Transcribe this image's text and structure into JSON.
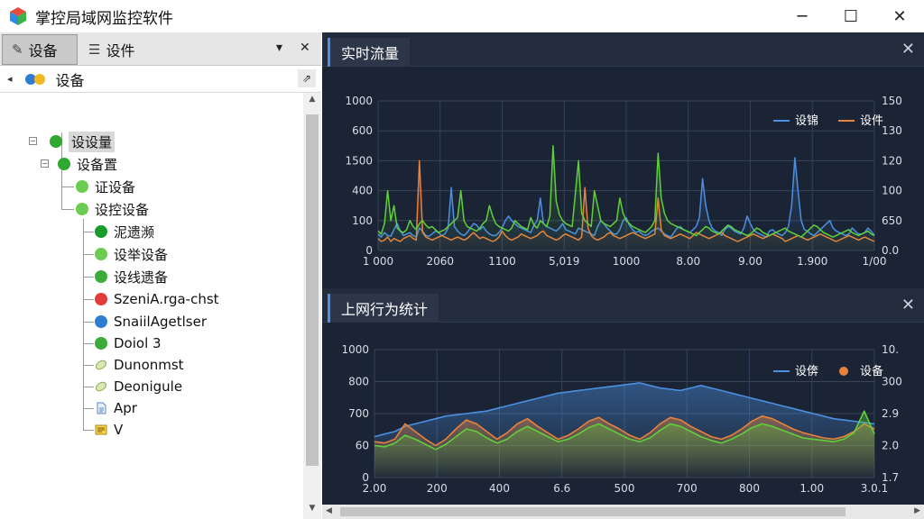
{
  "window": {
    "title": "掌控局域网监控软件",
    "minimize": "─",
    "maximize": "☐",
    "close": "✕"
  },
  "left_tabs": [
    {
      "label": "设备",
      "icon": "pen-icon"
    },
    {
      "label": "设件",
      "icon": "list-icon"
    }
  ],
  "tab_menu": "▾",
  "tab_close": "✕",
  "tree_root": {
    "label": "设备"
  },
  "tree": [
    {
      "label": "设设量",
      "color": "#2ea82e",
      "selected": true
    },
    {
      "label": "设备置",
      "color": "#2ea82e"
    },
    {
      "label": "证设备",
      "color": "#6ccc4f"
    },
    {
      "label": "设控设备",
      "color": "#6ccc4f"
    },
    {
      "label": "泥遗濒",
      "color": "#169c2a"
    },
    {
      "label": "设举设备",
      "color": "#6ccc4f"
    },
    {
      "label": "设线遗备",
      "color": "#3bab3b"
    },
    {
      "label": "SzeniA.rga-chst",
      "color": "#e23b3b"
    },
    {
      "label": "SnaiilAgetlser",
      "color": "#2f7dd1"
    },
    {
      "label": "Doiol 3",
      "color": "#3bab3b"
    },
    {
      "label": "Dunonmst",
      "icon": "leaf-icon"
    },
    {
      "label": "Deonigule",
      "icon": "leaf-icon"
    },
    {
      "label": "Apr",
      "icon": "doc-icon"
    },
    {
      "label": "V",
      "icon": "note-icon"
    }
  ],
  "colors": {
    "blue": "#4a90e2",
    "orange": "#e8823a",
    "green": "#5fcf3a",
    "accent": "#4d8fe0"
  },
  "panels": {
    "realtime": {
      "title": "实时流量",
      "close": "✕"
    },
    "behavior": {
      "title": "上网行为统计",
      "close": "✕"
    }
  },
  "chart_data": [
    {
      "type": "line",
      "legend": "top-right",
      "legend_items": [
        {
          "name": "设锦",
          "color": "#4a90e2"
        },
        {
          "name": "设件",
          "color": "#e8823a"
        }
      ],
      "y_ticks": [
        "1000",
        "600",
        "1500",
        "400",
        "100",
        "0"
      ],
      "y2_ticks": [
        "150",
        "130",
        "120",
        "100",
        "650",
        "0.0"
      ],
      "x_ticks": [
        "1 000",
        "2060",
        "1100",
        "5,019",
        "1000",
        "8.00",
        "9.00",
        "1.900",
        "1/00"
      ],
      "ylim": [
        0,
        1000
      ],
      "grid": true,
      "series": [
        {
          "color": "#4a90e2",
          "values": [
            110,
            90,
            120,
            100,
            95,
            140,
            180,
            130,
            100,
            110,
            120,
            100,
            90,
            150,
            130,
            100,
            95,
            110,
            130,
            120,
            100,
            110,
            150,
            420,
            160,
            130,
            110,
            100,
            120,
            150,
            180,
            170,
            140,
            160,
            130,
            110,
            100,
            100,
            120,
            150,
            200,
            230,
            200,
            180,
            160,
            150,
            140,
            130,
            120,
            170,
            200,
            350,
            180,
            160,
            150,
            140,
            130,
            150,
            180,
            140,
            130,
            120,
            110,
            150,
            140,
            130,
            120,
            110,
            100,
            160,
            200,
            180,
            150,
            130,
            110,
            110,
            140,
            200,
            220,
            170,
            140,
            120,
            130,
            110,
            100,
            110,
            130,
            140,
            150,
            130,
            110,
            100,
            90,
            120,
            150,
            160,
            140,
            130,
            120,
            140,
            160,
            220,
            480,
            300,
            200,
            150,
            130,
            120,
            100,
            140,
            160,
            150,
            130,
            120,
            110,
            150,
            230,
            180,
            140,
            120,
            110,
            100,
            90,
            130,
            140,
            120,
            110,
            100,
            120,
            160,
            300,
            620,
            400,
            200,
            140,
            130,
            110,
            100,
            120,
            140,
            160,
            180,
            200,
            150,
            130,
            120,
            110,
            100,
            110,
            150,
            130,
            110,
            110,
            120,
            150,
            130,
            100
          ]
        },
        {
          "color": "#e8823a",
          "values": [
            80,
            60,
            70,
            90,
            60,
            80,
            70,
            60,
            80,
            90,
            100,
            80,
            70,
            600,
            120,
            90,
            80,
            70,
            80,
            90,
            100,
            90,
            80,
            70,
            80,
            90,
            80,
            70,
            80,
            100,
            120,
            100,
            80,
            90,
            80,
            70,
            60,
            70,
            90,
            130,
            100,
            80,
            70,
            80,
            90,
            110,
            100,
            90,
            80,
            90,
            100,
            120,
            130,
            100,
            90,
            80,
            70,
            80,
            100,
            110,
            100,
            90,
            80,
            70,
            90,
            420,
            150,
            100,
            80,
            70,
            80,
            90,
            110,
            120,
            100,
            90,
            80,
            90,
            100,
            110,
            120,
            110,
            100,
            90,
            80,
            90,
            100,
            110,
            350,
            140,
            100,
            90,
            80,
            90,
            100,
            110,
            100,
            90,
            80,
            100,
            120,
            110,
            100,
            90,
            80,
            90,
            100,
            110,
            120,
            100,
            90,
            80,
            70,
            60,
            70,
            80,
            90,
            100,
            110,
            100,
            90,
            80,
            90,
            100,
            110,
            100,
            90,
            80,
            60,
            70,
            80,
            90,
            100,
            90,
            80,
            70,
            80,
            90,
            100,
            110,
            100,
            90,
            80,
            70,
            60,
            70,
            80,
            90,
            100,
            90,
            80,
            70,
            80,
            90,
            80,
            70,
            60
          ]
        },
        {
          "color": "#5fcf3a",
          "values": [
            130,
            110,
            180,
            400,
            200,
            300,
            150,
            130,
            120,
            140,
            200,
            160,
            140,
            180,
            200,
            170,
            150,
            160,
            140,
            120,
            130,
            140,
            160,
            180,
            200,
            220,
            400,
            200,
            160,
            150,
            140,
            130,
            150,
            180,
            200,
            300,
            230,
            180,
            160,
            150,
            140,
            130,
            150,
            200,
            180,
            160,
            150,
            140,
            220,
            170,
            150,
            200,
            180,
            160,
            230,
            700,
            330,
            240,
            200,
            180,
            170,
            160,
            380,
            600,
            250,
            200,
            180,
            160,
            400,
            300,
            200,
            180,
            170,
            160,
            180,
            200,
            350,
            250,
            200,
            180,
            160,
            150,
            140,
            130,
            120,
            140,
            160,
            200,
            650,
            350,
            250,
            200,
            180,
            170,
            160,
            150,
            140,
            130,
            120,
            110,
            100,
            120,
            140,
            160,
            150,
            130,
            120,
            110,
            130,
            150,
            170,
            160,
            140,
            130,
            120,
            110,
            100,
            110,
            130,
            150,
            140,
            120,
            110,
            100,
            110,
            120,
            130,
            140,
            150,
            130,
            120,
            110,
            100,
            90,
            110,
            130,
            150,
            170,
            160,
            140,
            120,
            110,
            100,
            90,
            100,
            110,
            120,
            130,
            140,
            120,
            110,
            100,
            110,
            120,
            130,
            110,
            100
          ]
        }
      ]
    },
    {
      "type": "area",
      "legend": "top-right",
      "legend_items": [
        {
          "name": "设倴",
          "color": "#4a90e2"
        },
        {
          "name": "设备",
          "color": "#e8823a"
        }
      ],
      "y_ticks": [
        "1000",
        "800",
        "700",
        "60",
        "0"
      ],
      "y2_ticks": [
        "10.",
        "300",
        "2.9",
        "2.0",
        "1.7"
      ],
      "x_ticks": [
        "2.00",
        "200",
        "400",
        "6.6",
        "500",
        "700",
        "800",
        "1.00",
        "3.0.1"
      ],
      "ylim": [
        0,
        1000
      ],
      "grid": true,
      "series": [
        {
          "color": "#4a90e2",
          "values": [
            320,
            340,
            360,
            400,
            420,
            440,
            460,
            480,
            490,
            500,
            510,
            520,
            540,
            560,
            580,
            600,
            620,
            640,
            660,
            670,
            680,
            690,
            700,
            710,
            720,
            730,
            740,
            720,
            700,
            690,
            680,
            700,
            720,
            700,
            680,
            660,
            640,
            620,
            600,
            580,
            560,
            540,
            520,
            500,
            480,
            460,
            450,
            440,
            430,
            420
          ]
        },
        {
          "color": "#e8823a",
          "values": [
            280,
            270,
            300,
            420,
            360,
            300,
            250,
            300,
            380,
            450,
            420,
            360,
            300,
            350,
            420,
            460,
            400,
            350,
            300,
            330,
            380,
            440,
            470,
            420,
            380,
            330,
            300,
            350,
            420,
            470,
            450,
            400,
            360,
            320,
            300,
            330,
            380,
            440,
            480,
            460,
            420,
            380,
            350,
            330,
            310,
            300,
            320,
            360,
            420,
            380
          ]
        },
        {
          "color": "#5fcf3a",
          "values": [
            250,
            240,
            270,
            330,
            300,
            260,
            220,
            260,
            320,
            380,
            360,
            310,
            270,
            300,
            360,
            400,
            360,
            320,
            280,
            300,
            340,
            390,
            420,
            380,
            340,
            300,
            280,
            310,
            370,
            420,
            400,
            360,
            320,
            290,
            270,
            300,
            340,
            390,
            420,
            400,
            370,
            340,
            310,
            300,
            290,
            280,
            300,
            350,
            520,
            340
          ]
        }
      ]
    }
  ]
}
